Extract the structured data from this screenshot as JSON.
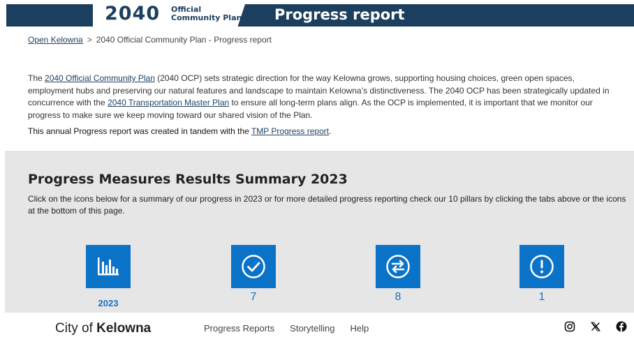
{
  "header": {
    "logo_number": "2040",
    "logo_line1": "Official",
    "logo_line2": "Community Plan",
    "title": "Progress report"
  },
  "breadcrumb": {
    "home": "Open Kelowna",
    "separator": ">",
    "current": "2040 Official Community Plan - Progress report"
  },
  "intro": {
    "p1_before": "The ",
    "p1_link1": "2040 Official Community Plan",
    "p1_mid": " (2040 OCP) sets strategic direction for the way Kelowna grows, supporting housing choices, green open spaces, employment hubs and preserving our natural features and landscape to maintain Kelowna’s distinctiveness. The 2040 OCP has been strategically updated in concurrence with the ",
    "p1_link2": "2040 Transportation Master Plan",
    "p1_after": " to ensure all long-term plans align. As the OCP is implemented, it is important that we monitor our progress to make sure we keep moving toward our shared vision of the Plan.",
    "p2_before": "This annual Progress report was created in tandem with the ",
    "p2_link": "TMP Progress report",
    "p2_after": "."
  },
  "summary": {
    "title": "Progress Measures Results Summary 2023",
    "description": "Click on the icons below for a summary of our progress in 2023 or for more detailed progress reporting check our 10 pillars by clicking the tabs above or the icons at the bottom of this page.",
    "tiles": [
      {
        "icon": "bar-chart-icon",
        "label": "2023"
      },
      {
        "icon": "check-circle-icon",
        "label": "7"
      },
      {
        "icon": "arrows-circle-icon",
        "label": "8"
      },
      {
        "icon": "exclamation-circle-icon",
        "label": "1"
      }
    ],
    "tile_color": "#0b73c7"
  },
  "footer": {
    "logo_prefix": "City of ",
    "logo_bold": "Kelowna",
    "links": [
      "Progress Reports",
      "Storytelling",
      "Help"
    ],
    "social": [
      "instagram-icon",
      "x-icon",
      "facebook-icon"
    ]
  },
  "colors": {
    "banner": "#1c3f5f",
    "summary_background": "#e6e6e6"
  }
}
